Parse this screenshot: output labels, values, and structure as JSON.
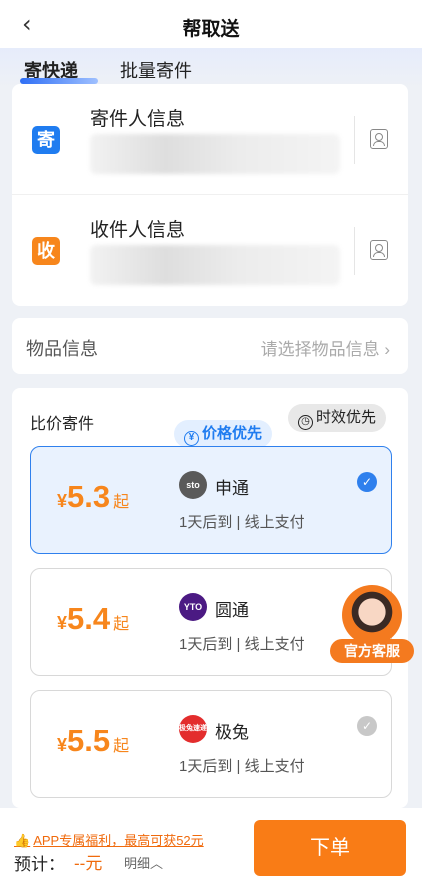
{
  "header": {
    "back_icon": "chevron-left-icon",
    "title": "帮取送"
  },
  "tabs": [
    {
      "label": "寄快递"
    },
    {
      "label": "批量寄件"
    }
  ],
  "sender": {
    "tag": "寄",
    "title": "寄件人信息"
  },
  "receiver": {
    "tag": "收",
    "title": "收件人信息"
  },
  "goods": {
    "label": "物品信息",
    "placeholder": "请选择物品信息 ›"
  },
  "compare": {
    "label": "比价寄件",
    "sort_price": "价格优先",
    "sort_time": "时效优先",
    "options": [
      {
        "currency": "¥",
        "price": "5.3",
        "suffix": "起",
        "logo": "sto",
        "carrier": "申通",
        "desc": "1天后到 | 线上支付",
        "selected": true
      },
      {
        "currency": "¥",
        "price": "5.4",
        "suffix": "起",
        "logo": "YTO",
        "carrier": "圆通",
        "desc": "1天后到 | 线上支付",
        "selected": false
      },
      {
        "currency": "¥",
        "price": "5.5",
        "suffix": "起",
        "logo": "极兔速递",
        "carrier": "极兔",
        "desc": "1天后到 | 线上支付",
        "selected": false
      }
    ]
  },
  "customer_service": {
    "label": "官方客服"
  },
  "footer": {
    "promo": "APP专属福利，最高可获52元",
    "estimate_label": "预计：",
    "estimate_value": "--元",
    "detail": "明细︿",
    "order_button": "下单"
  },
  "colors": {
    "accent_blue": "#2f80ed",
    "accent_orange": "#f97c16"
  }
}
